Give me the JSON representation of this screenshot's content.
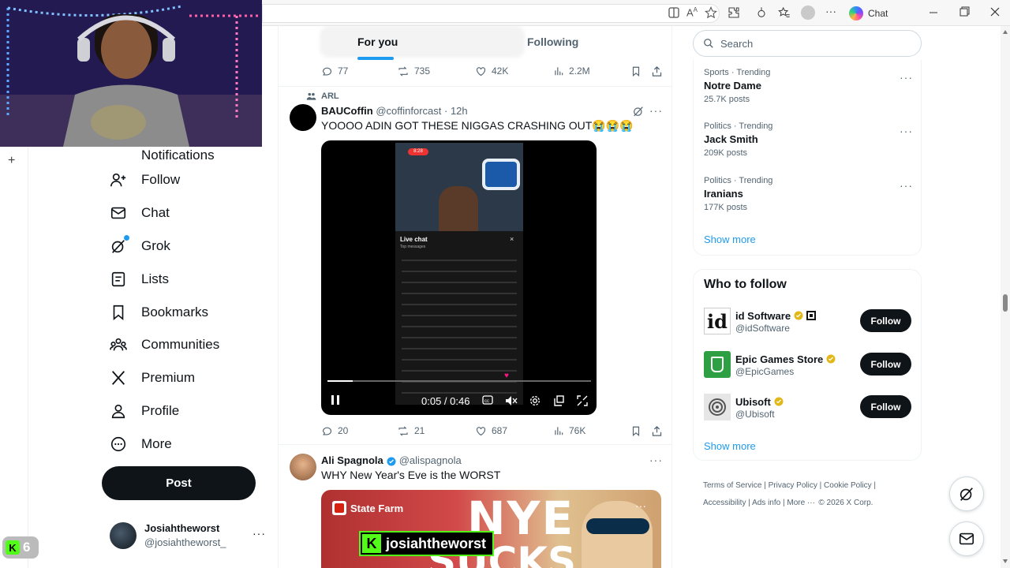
{
  "browser": {
    "chat_label": "Chat"
  },
  "sidebar": {
    "partial_item": "Notifications",
    "items": [
      {
        "label": "Follow",
        "icon": "follow-icon"
      },
      {
        "label": "Chat",
        "icon": "chat-icon"
      },
      {
        "label": "Grok",
        "icon": "grok-icon"
      },
      {
        "label": "Lists",
        "icon": "lists-icon"
      },
      {
        "label": "Bookmarks",
        "icon": "bookmark-icon"
      },
      {
        "label": "Communities",
        "icon": "communities-icon"
      },
      {
        "label": "Premium",
        "icon": "x-logo-icon"
      },
      {
        "label": "Profile",
        "icon": "profile-icon"
      },
      {
        "label": "More",
        "icon": "more-circle-icon"
      }
    ],
    "post_label": "Post",
    "account": {
      "name": "Josiahtheworst",
      "handle": "@josiahtheworst_"
    }
  },
  "overlay": {
    "badge_count": "6",
    "badge_letter": "K"
  },
  "feed": {
    "tabs": [
      "For you",
      "Following"
    ],
    "top_actions": {
      "replies": "77",
      "reposts": "735",
      "likes": "42K",
      "views": "2.2M"
    },
    "tweet1": {
      "community": "ARL",
      "name": "BAUCoffin",
      "handle": "@coffinforcast",
      "time": "· 12h",
      "text": "YOOOO ADIN GOT THESE NIGGAS CRASHING OUT😭😭😭",
      "video_time": "0:05 / 0:46",
      "video_phone_time": "8:28",
      "video_live_chat": "Live chat",
      "video_top_messages": "Top messages",
      "actions": {
        "replies": "20",
        "reposts": "21",
        "likes": "687",
        "views": "76K"
      }
    },
    "tweet2": {
      "name": "Ali Spagnola",
      "handle": "@alispagnola",
      "text": "WHY New Year's Eve is the WORST",
      "thumb_brand": "State Farm",
      "thumb_big_text": "NYE",
      "thumb_big_text2": "SUCKS",
      "thumb_watermark": "josiahtheworst"
    }
  },
  "right": {
    "search_placeholder": "Search",
    "trends": [
      {
        "meta": "Sports · Trending",
        "name": "Notre Dame",
        "count": "25.7K posts"
      },
      {
        "meta": "Politics · Trending",
        "name": "Jack Smith",
        "count": "209K posts"
      },
      {
        "meta": "Politics · Trending",
        "name": "Iranians",
        "count": "177K posts"
      }
    ],
    "show_more": "Show more",
    "who_to_follow_title": "Who to follow",
    "who_to_follow": [
      {
        "name": "id Software",
        "handle": "@idSoftware",
        "button": "Follow"
      },
      {
        "name": "Epic Games Store",
        "handle": "@EpicGames",
        "button": "Follow"
      },
      {
        "name": "Ubisoft",
        "handle": "@Ubisoft",
        "button": "Follow"
      }
    ],
    "show_more_2": "Show more",
    "footer": {
      "terms": "Terms of Service",
      "privacy": "Privacy Policy",
      "cookie": "Cookie Policy",
      "accessibility": "Accessibility",
      "ads": "Ads info",
      "more": "More ···",
      "copyright": "© 2026 X Corp."
    }
  },
  "colors": {
    "accent": "#1d9bf0",
    "text": "#0f1419",
    "muted": "#536471",
    "like_red": "#f91880"
  }
}
